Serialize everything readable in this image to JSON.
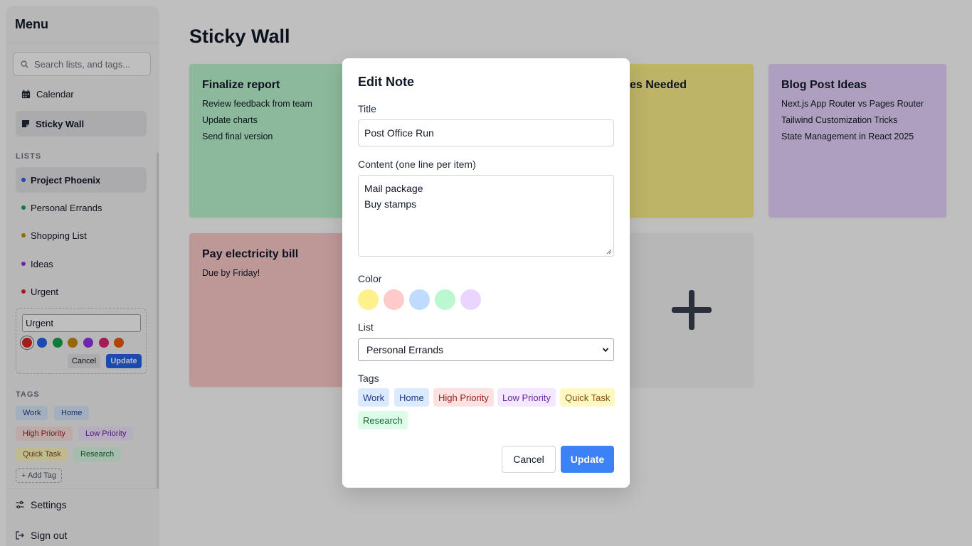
{
  "sidebar": {
    "title": "Menu",
    "search_placeholder": "Search lists, and tags...",
    "nav": [
      {
        "label": "Calendar",
        "icon": "calendar-icon"
      },
      {
        "label": "Sticky Wall",
        "icon": "sticky-note-icon",
        "active": true
      }
    ],
    "lists_label": "LISTS",
    "lists": [
      {
        "label": "Project Phoenix",
        "color": "#2563eb",
        "active": true
      },
      {
        "label": "Personal Errands",
        "color": "#16a34a"
      },
      {
        "label": "Shopping List",
        "color": "#ca8a04"
      },
      {
        "label": "Ideas",
        "color": "#9333ea"
      },
      {
        "label": "Urgent",
        "color": "#dc2626"
      }
    ],
    "edit_list": {
      "value": "Urgent",
      "colors": [
        "#dc2626",
        "#2563eb",
        "#16a34a",
        "#ca8a04",
        "#9333ea",
        "#db2777",
        "#ea580c"
      ],
      "selected_color": "#dc2626",
      "cancel": "Cancel",
      "update": "Update"
    },
    "tags_label": "TAGS",
    "tags": [
      {
        "label": "Work",
        "bg": "#dbeafe",
        "fg": "#1e3a8a"
      },
      {
        "label": "Home",
        "bg": "#dbeafe",
        "fg": "#1e3a8a"
      },
      {
        "label": "High Priority",
        "bg": "#fee2e2",
        "fg": "#991b1b"
      },
      {
        "label": "Low Priority",
        "bg": "#f3e8ff",
        "fg": "#6b21a8"
      },
      {
        "label": "Quick Task",
        "bg": "#fef9c3",
        "fg": "#854d0e"
      },
      {
        "label": "Research",
        "bg": "#dcfce7",
        "fg": "#166534"
      }
    ],
    "add_tag": "+ Add Tag",
    "settings": "Settings",
    "sign_out": "Sign out"
  },
  "main": {
    "title": "Sticky Wall",
    "cards": [
      {
        "title": "Finalize report",
        "lines": [
          "Review feedback from team",
          "Update charts",
          "Send final version"
        ],
        "color": "green"
      },
      {
        "title": "es Needed",
        "lines": [],
        "color": "yellow"
      },
      {
        "title": "Blog Post Ideas",
        "lines": [
          "Next.js App Router vs Pages Router",
          "Tailwind Customization Tricks",
          "State Management in React 2025"
        ],
        "color": "purple"
      },
      {
        "title": "Pay electricity bill",
        "lines": [
          "Due by Friday!"
        ],
        "color": "pink"
      }
    ],
    "add_card_icon": "plus-icon"
  },
  "modal": {
    "title": "Edit Note",
    "title_label": "Title",
    "title_value": "Post Office Run",
    "content_label": "Content (one line per item)",
    "content_lines": [
      "Mail package",
      "Buy stamps"
    ],
    "color_label": "Color",
    "colors": [
      "#fef08a",
      "#fecaca",
      "#bfdbfe",
      "#bbf7d0",
      "#e9d5ff"
    ],
    "list_label": "List",
    "list_value": "Personal Errands",
    "tags_label": "Tags",
    "tags": [
      {
        "label": "Work",
        "bg": "#dbeafe",
        "fg": "#1e3a8a"
      },
      {
        "label": "Home",
        "bg": "#dbeafe",
        "fg": "#1e3a8a"
      },
      {
        "label": "High Priority",
        "bg": "#fee2e2",
        "fg": "#991b1b"
      },
      {
        "label": "Low Priority",
        "bg": "#f3e8ff",
        "fg": "#6b21a8"
      },
      {
        "label": "Quick Task",
        "bg": "#fef9c3",
        "fg": "#854d0e"
      },
      {
        "label": "Research",
        "bg": "#dcfce7",
        "fg": "#166534"
      }
    ],
    "cancel": "Cancel",
    "update": "Update"
  }
}
